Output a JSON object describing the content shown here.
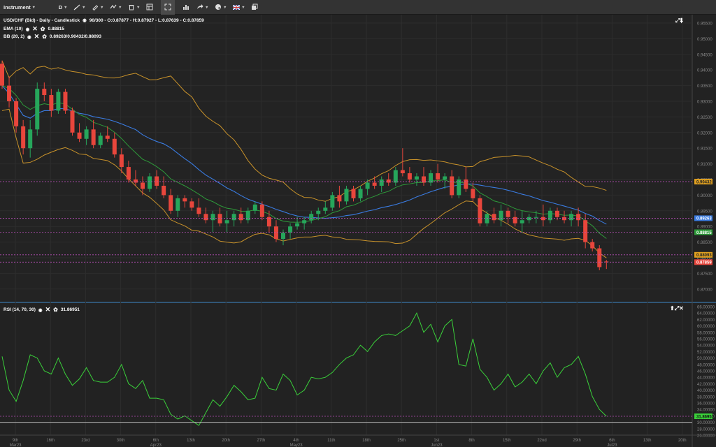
{
  "toolbar": {
    "instrument_label": "Instrument",
    "timeframe_label": "D",
    "items": [
      "drawing-tool",
      "pencil-tool",
      "indicators",
      "delete",
      "layout",
      "crosshair",
      "chart-type",
      "share",
      "theme",
      "language",
      "window"
    ]
  },
  "main_panel": {
    "title": "USD/CHF (Bid) - Daily - Candlestick",
    "ohlc": "90/300 - O:0.87877 - H:0.87927 - L:0.87639 - C:0.87859",
    "ema_label": "EMA (10)",
    "ema_value": "0.88815",
    "bb_label": "BB (20, 2)",
    "bb_value": "0.89263/0.90432/0.88093",
    "price_ticks": [
      "0.95500",
      "0.95000",
      "0.94500",
      "0.94000",
      "0.93500",
      "0.93000",
      "0.92500",
      "0.92000",
      "0.91500",
      "0.91000",
      "0.90500",
      "0.90000",
      "0.89500",
      "0.89000",
      "0.88500",
      "0.88000",
      "0.87500",
      "0.87000"
    ],
    "markers": [
      {
        "label": "0.90432",
        "color": "#e0a020",
        "text_color": "#222"
      },
      {
        "label": "0.89263",
        "color": "#3a7be0",
        "text_color": "#fff"
      },
      {
        "label": "0.88815",
        "color": "#2e9a3a",
        "text_color": "#fff"
      },
      {
        "label": "0.88093",
        "color": "#e0a020",
        "text_color": "#222"
      },
      {
        "label": "0.87859",
        "color": "#e8463c",
        "text_color": "#fff"
      }
    ]
  },
  "rsi_panel": {
    "title": "RSI (14, 70, 30)",
    "value": "31.86951",
    "ticks": [
      "66.00000",
      "64.00000",
      "62.00000",
      "60.00000",
      "58.00000",
      "56.00000",
      "54.00000",
      "52.00000",
      "50.00000",
      "48.00000",
      "46.00000",
      "44.00000",
      "42.00000",
      "40.00000",
      "38.00000",
      "36.00000",
      "34.00000",
      "32.00000",
      "30.00000",
      "28.00000",
      "26.00000"
    ],
    "marker": {
      "label": "31.86951",
      "color": "#3ad03a"
    }
  },
  "x_axis": {
    "labels": [
      "9th",
      "16th",
      "23rd",
      "30th",
      "6th",
      "13th",
      "20th",
      "27th",
      "4th",
      "11th",
      "18th",
      "25th",
      "1st",
      "8th",
      "15th",
      "22nd",
      "29th",
      "6th",
      "13th",
      "20th"
    ],
    "months": [
      "Mar23",
      "Apr23",
      "May23",
      "Jun23",
      "Jul23"
    ]
  },
  "colors": {
    "up": "#26a65b",
    "down": "#e8463c",
    "ema": "#2e9a3a",
    "bb_mid": "#3a7be0",
    "bb_band": "#c8922a",
    "rsi": "#3ad03a"
  }
}
